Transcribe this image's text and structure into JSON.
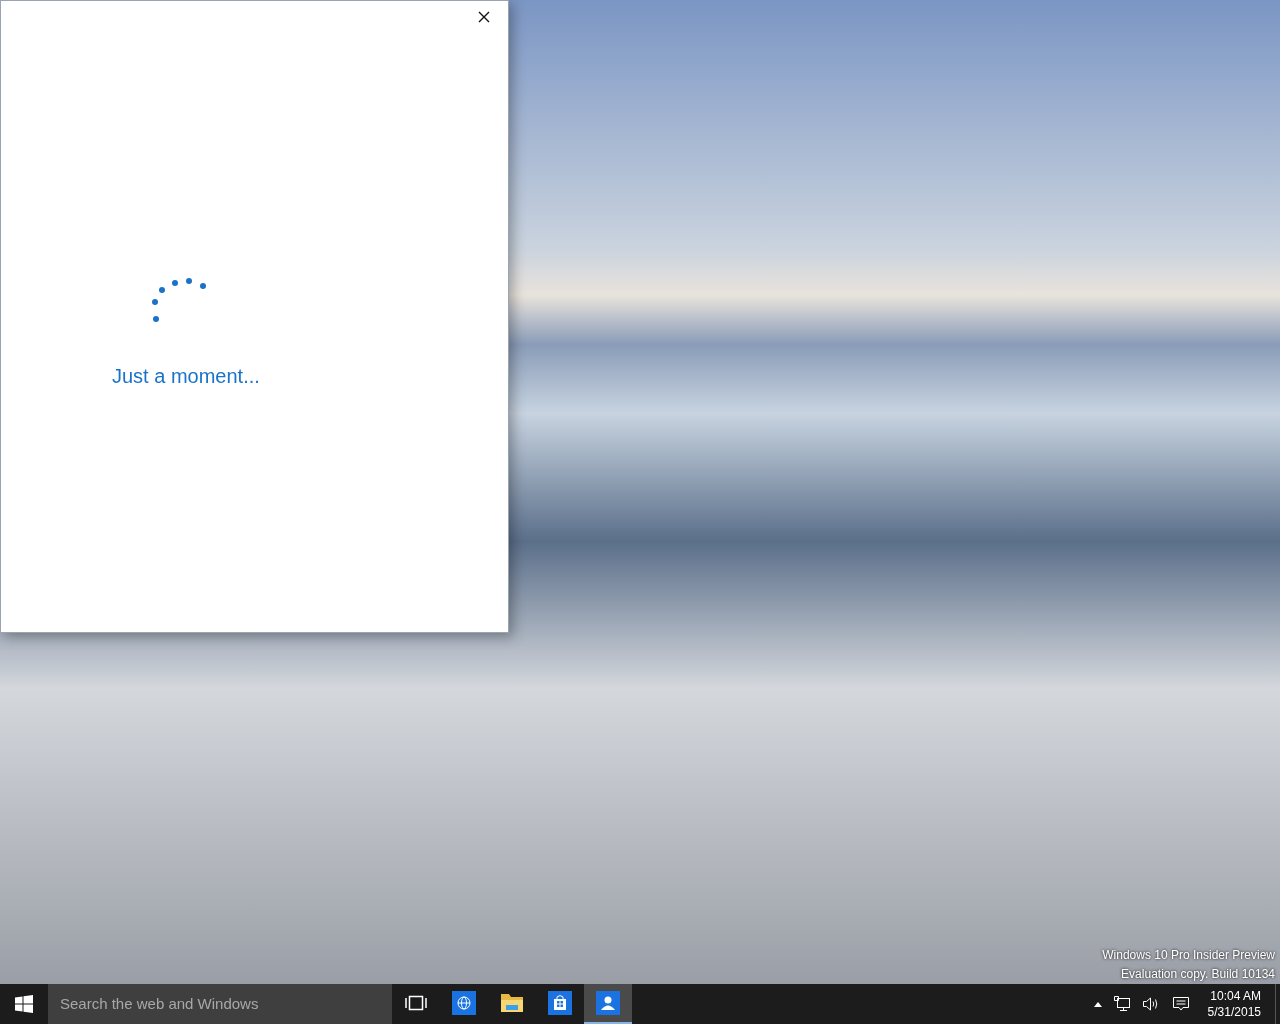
{
  "dialog": {
    "message": "Just a moment..."
  },
  "desktop": {
    "edition_notice": [
      "Windows 10 Pro Insider Preview",
      "Evaluation copy. Build 10134"
    ]
  },
  "taskbar": {
    "search": {
      "placeholder": "Search the web and Windows"
    },
    "apps": [
      {
        "kind": "taskview",
        "selected": false
      },
      {
        "kind": "browser",
        "selected": false
      },
      {
        "kind": "files",
        "selected": false
      },
      {
        "kind": "store",
        "selected": false
      },
      {
        "kind": "people",
        "selected": true
      }
    ],
    "clock": {
      "time": "10:04 AM",
      "date": "5/31/2015"
    }
  }
}
